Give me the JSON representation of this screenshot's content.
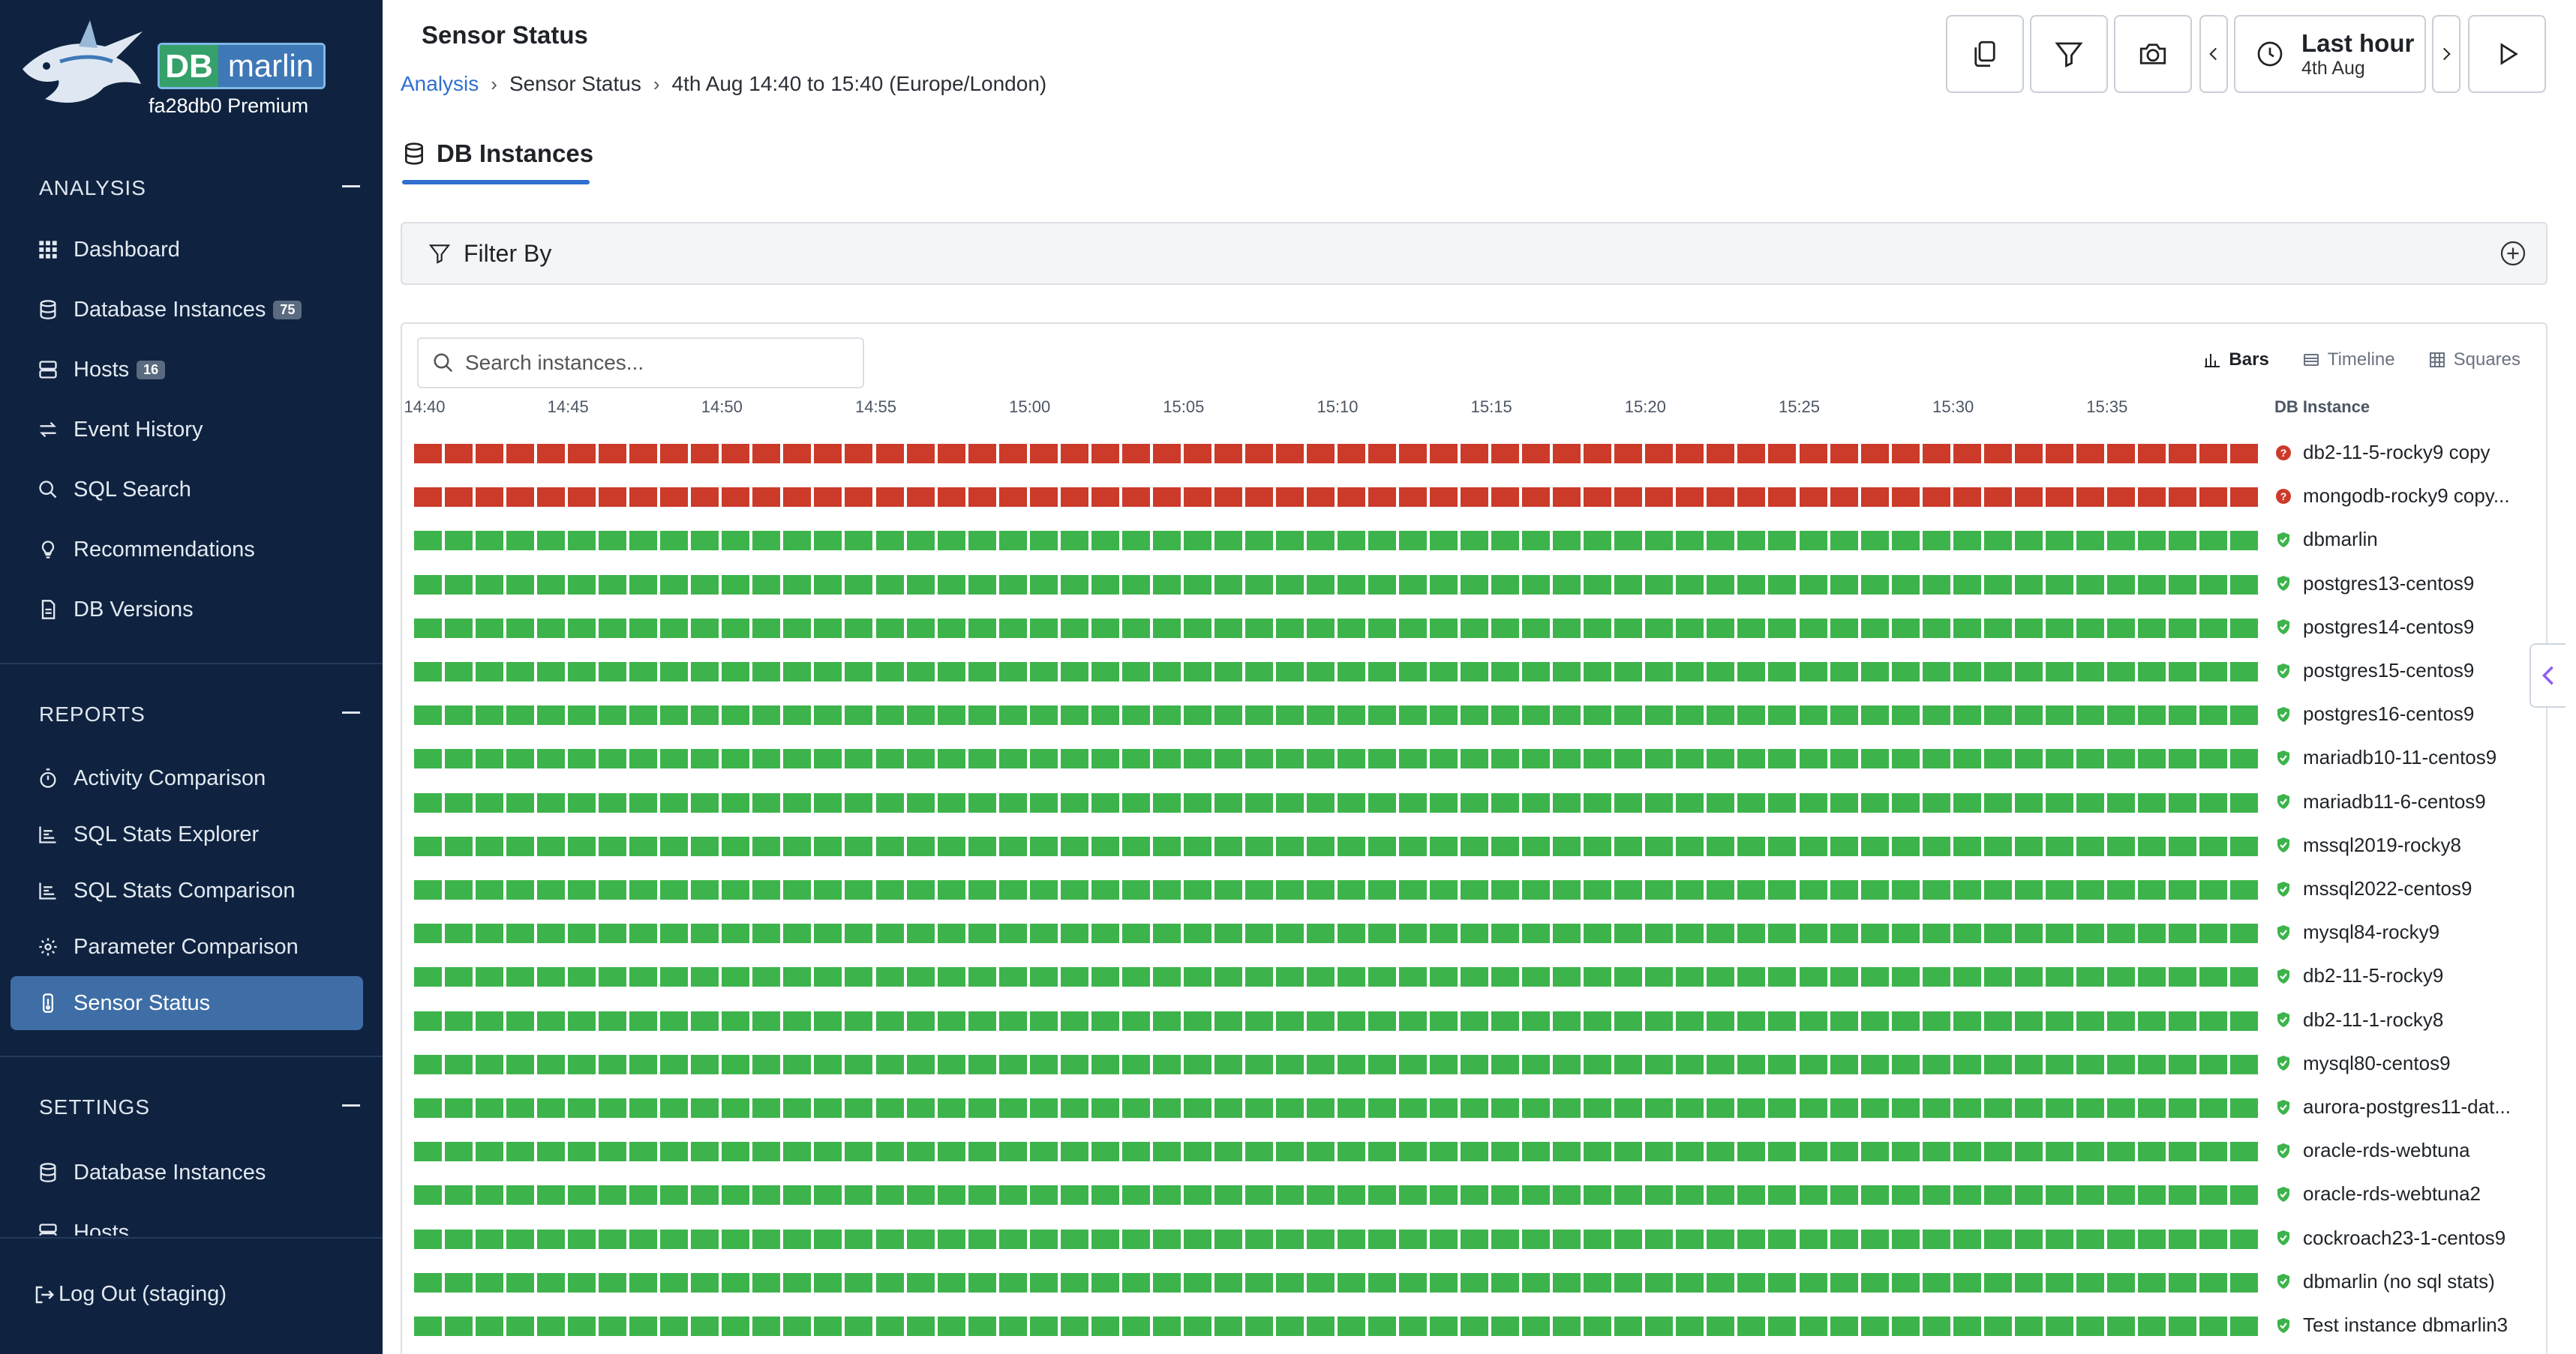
{
  "brand": {
    "logo_db": "DB",
    "logo_marlin": "marlin",
    "subtitle": "fa28db0 Premium"
  },
  "sidebar": {
    "analysis_header": "ANALYSIS",
    "analysis_items": [
      {
        "label": "Dashboard",
        "icon": "grid-icon"
      },
      {
        "label": "Database Instances",
        "icon": "database-icon",
        "count": "75"
      },
      {
        "label": "Hosts",
        "icon": "server-icon",
        "count": "16"
      },
      {
        "label": "Event History",
        "icon": "swap-arrows-icon"
      },
      {
        "label": "SQL Search",
        "icon": "search-icon"
      },
      {
        "label": "Recommendations",
        "icon": "lightbulb-icon"
      },
      {
        "label": "DB Versions",
        "icon": "document-icon"
      }
    ],
    "reports_header": "REPORTS",
    "reports_items": [
      {
        "label": "Activity Comparison",
        "icon": "stopwatch-icon"
      },
      {
        "label": "SQL Stats Explorer",
        "icon": "bar-list-icon"
      },
      {
        "label": "SQL Stats Comparison",
        "icon": "bar-list-icon"
      },
      {
        "label": "Parameter Comparison",
        "icon": "gear-icon"
      },
      {
        "label": "Sensor Status",
        "icon": "sensor-icon",
        "active": true
      }
    ],
    "settings_header": "SETTINGS",
    "settings_items": [
      {
        "label": "Database Instances",
        "icon": "database-icon"
      },
      {
        "label": "Hosts",
        "icon": "server-icon"
      }
    ],
    "logout": "Log Out (staging)"
  },
  "header": {
    "title": "Sensor Status",
    "breadcrumb": [
      "Analysis",
      "Sensor Status",
      "4th Aug 14:40 to 15:40 (Europe/London)"
    ],
    "time_range_label": "Last hour",
    "time_range_date": "4th Aug"
  },
  "tab": {
    "label": "DB Instances"
  },
  "filter": {
    "label": "Filter By"
  },
  "search": {
    "placeholder": "Search instances..."
  },
  "views": {
    "bars": "Bars",
    "timeline": "Timeline",
    "squares": "Squares",
    "selected": "Bars"
  },
  "colors": {
    "ok": "#3cb44b",
    "error": "#cc3a2a",
    "accent": "#2f6fd0",
    "sidebar": "#0f2340"
  },
  "status_grid": {
    "column_header": "DB Instance",
    "time_ticks": [
      "14:40",
      "14:45",
      "14:50",
      "14:55",
      "15:00",
      "15:05",
      "15:10",
      "15:15",
      "15:20",
      "15:25",
      "15:30",
      "15:35"
    ],
    "buckets_per_row": 60,
    "instances": [
      {
        "name": "db2-11-5-rocky9 copy",
        "status": "error"
      },
      {
        "name": "mongodb-rocky9 copy...",
        "status": "error"
      },
      {
        "name": "dbmarlin",
        "status": "ok"
      },
      {
        "name": "postgres13-centos9",
        "status": "ok"
      },
      {
        "name": "postgres14-centos9",
        "status": "ok"
      },
      {
        "name": "postgres15-centos9",
        "status": "ok"
      },
      {
        "name": "postgres16-centos9",
        "status": "ok"
      },
      {
        "name": "mariadb10-11-centos9",
        "status": "ok"
      },
      {
        "name": "mariadb11-6-centos9",
        "status": "ok"
      },
      {
        "name": "mssql2019-rocky8",
        "status": "ok"
      },
      {
        "name": "mssql2022-centos9",
        "status": "ok"
      },
      {
        "name": "mysql84-rocky9",
        "status": "ok"
      },
      {
        "name": "db2-11-5-rocky9",
        "status": "ok"
      },
      {
        "name": "db2-11-1-rocky8",
        "status": "ok"
      },
      {
        "name": "mysql80-centos9",
        "status": "ok"
      },
      {
        "name": "aurora-postgres11-dat...",
        "status": "ok"
      },
      {
        "name": "oracle-rds-webtuna",
        "status": "ok"
      },
      {
        "name": "oracle-rds-webtuna2",
        "status": "ok"
      },
      {
        "name": "cockroach23-1-centos9",
        "status": "ok"
      },
      {
        "name": "dbmarlin (no sql stats)",
        "status": "ok"
      },
      {
        "name": "Test instance dbmarlin3",
        "status": "ok"
      }
    ]
  }
}
